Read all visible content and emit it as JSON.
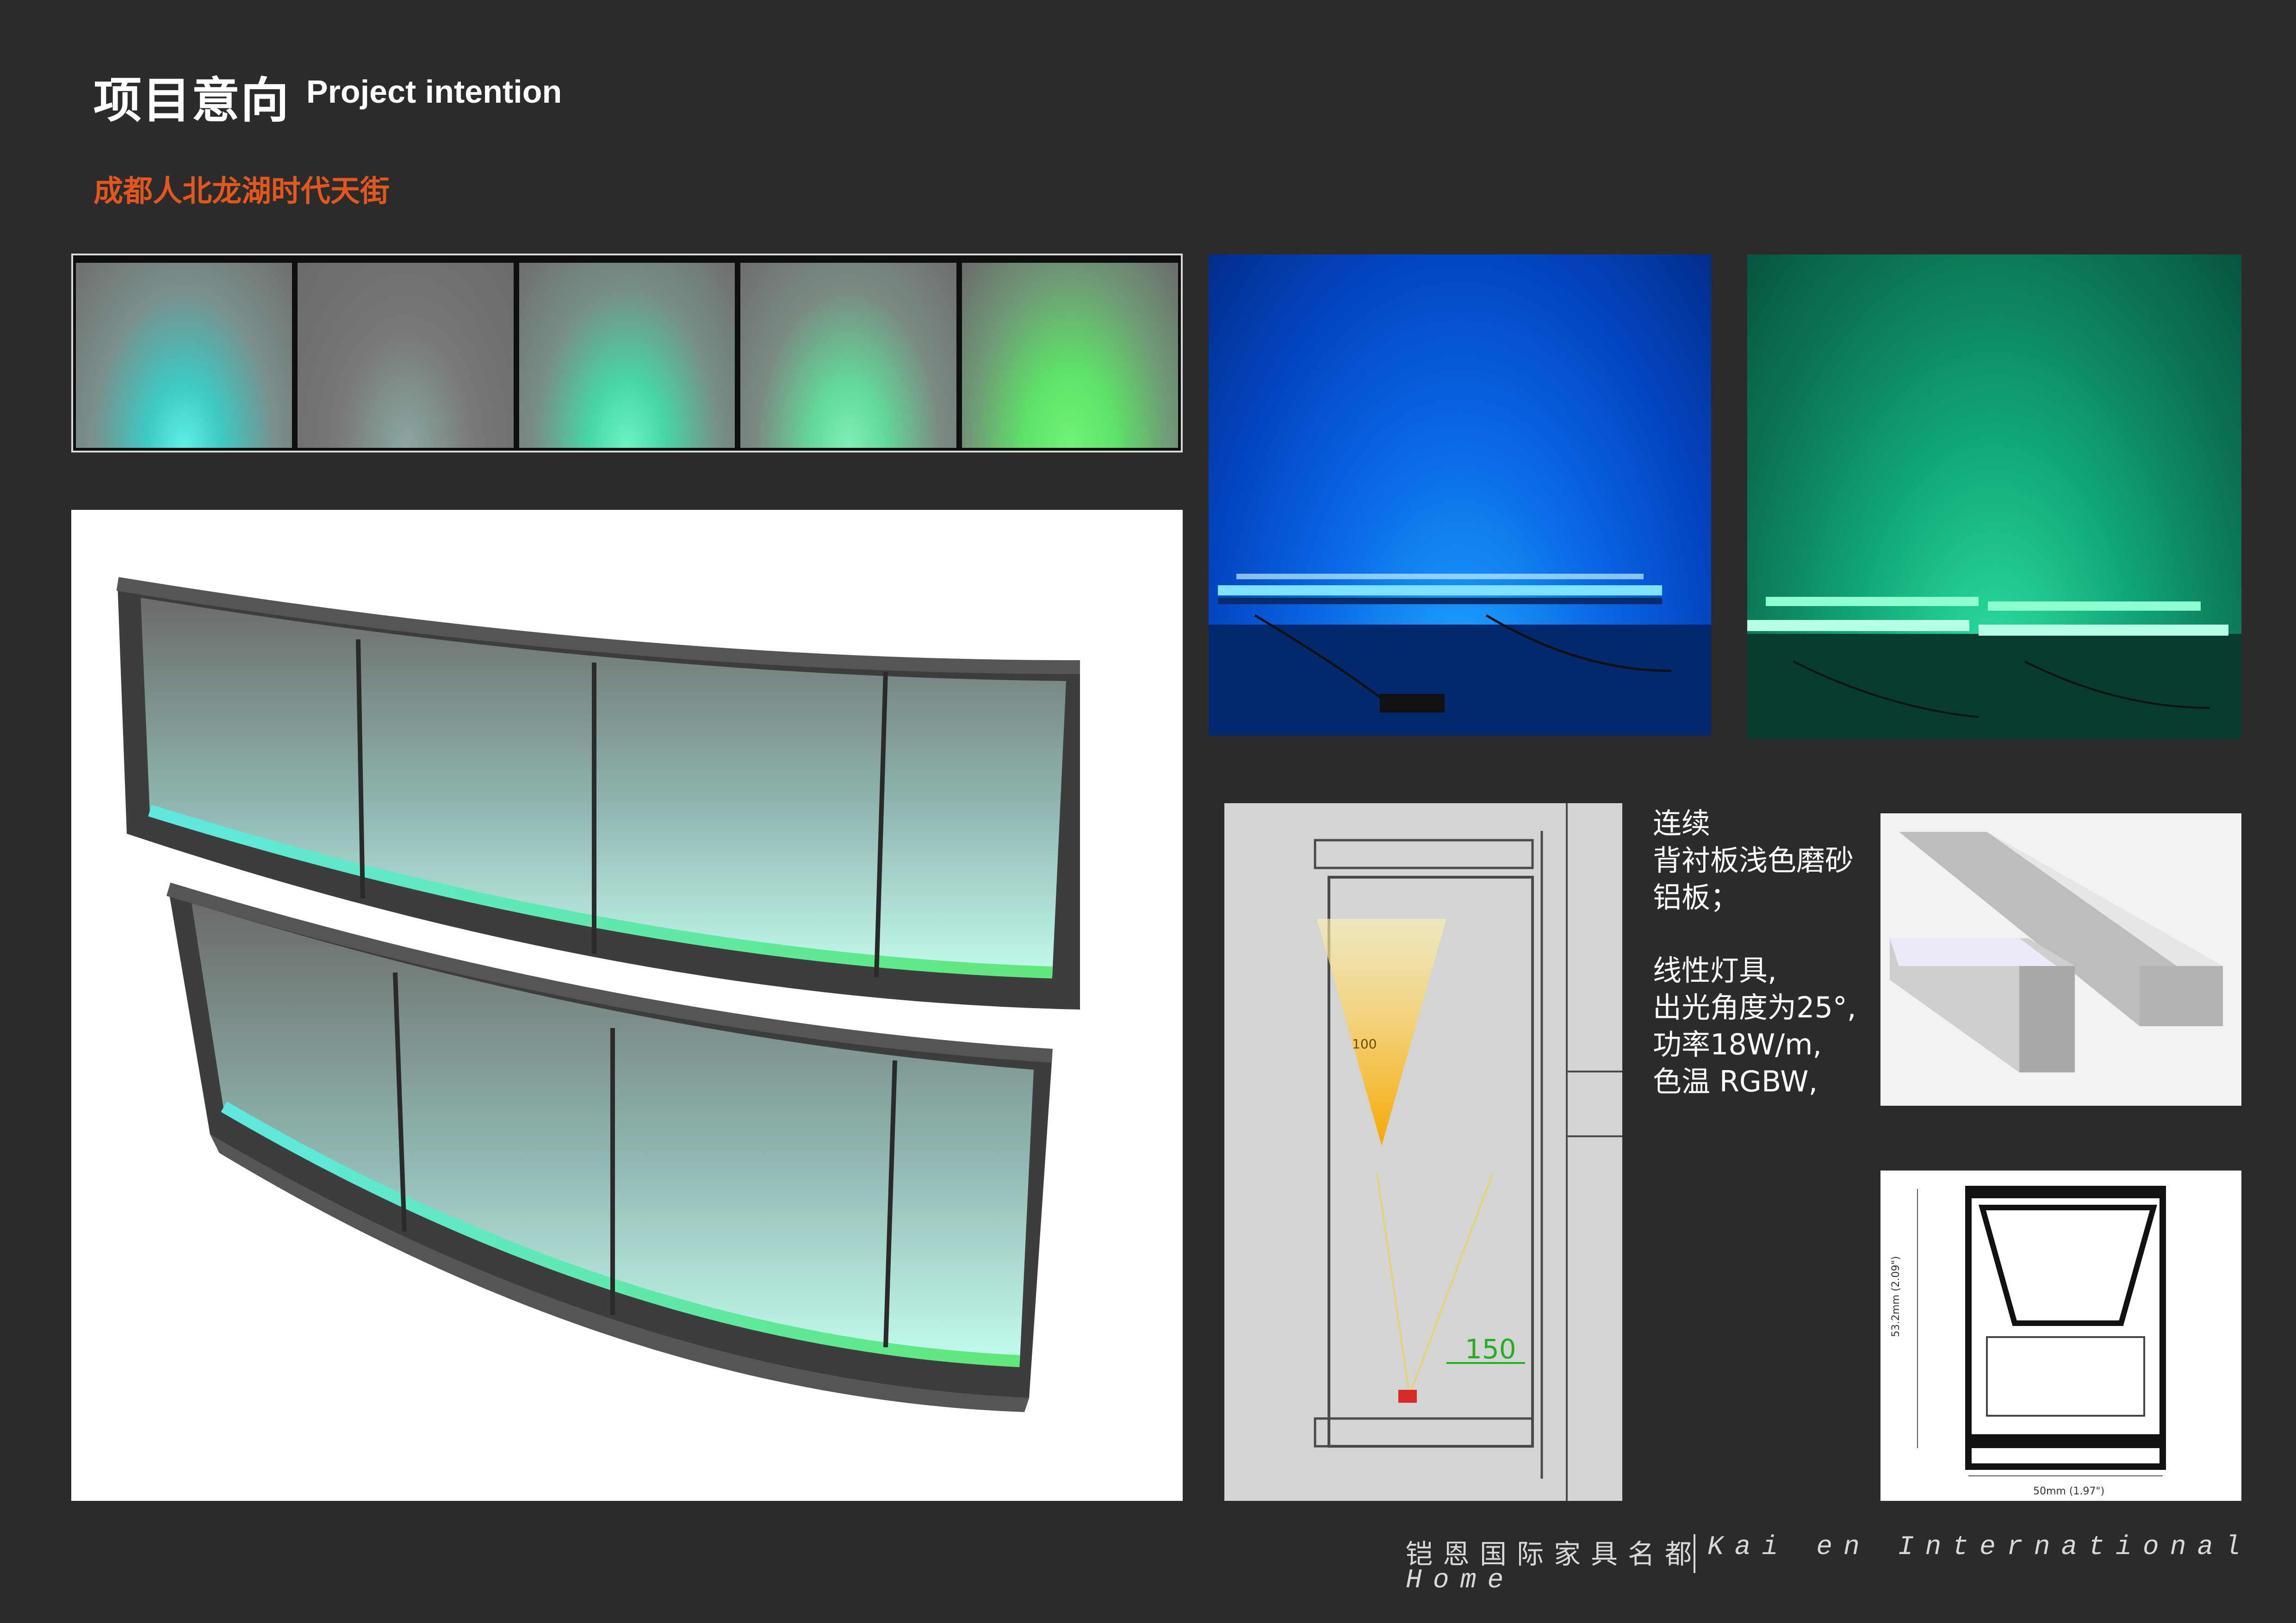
{
  "header": {
    "title_cn": "项目意向",
    "title_en": "Project intention",
    "subtitle": "成都人北龙湖时代天街"
  },
  "swatches": [
    {
      "name": "cyan",
      "color": "#4fe3d0"
    },
    {
      "name": "grey",
      "color": "#7f8a86"
    },
    {
      "name": "aqua-green",
      "color": "#52f0b0"
    },
    {
      "name": "soft-green",
      "color": "#6aeaa0"
    },
    {
      "name": "bright-green",
      "color": "#68f07a"
    }
  ],
  "section_drawing": {
    "beam_label": "100",
    "dimension_label": "150"
  },
  "spec": {
    "line1": "连续",
    "line2": "背衬板浅色磨砂",
    "line3": "铝板；",
    "line4": "线性灯具,",
    "line5": "出光角度为25°,",
    "line6": "功率18W/m,",
    "line7": "色温 RGBW,"
  },
  "profile_drawing": {
    "height_label": "53.2mm (2.09\")",
    "width_label": "50mm (1.97\")"
  },
  "footer": {
    "brand_cn": "铠恩国际家具名都",
    "brand_en_line1": "Kai en International",
    "brand_en_line2": "Home"
  },
  "colors": {
    "background": "#2b2b2b",
    "accent_orange": "#e2571e",
    "led_cyan": "#3fe6d6",
    "led_green": "#3ce27a"
  }
}
